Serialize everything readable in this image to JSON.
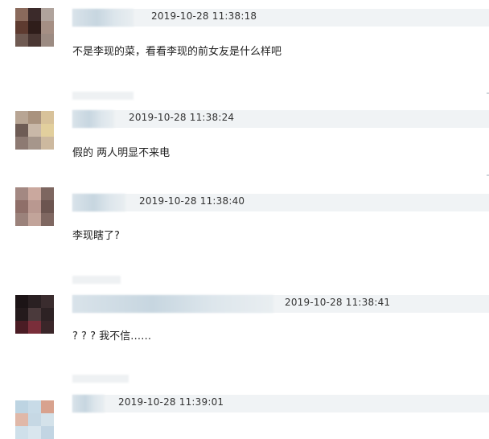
{
  "comments": [
    {
      "timestamp": "2019-10-28 11:38:18",
      "text": "不是李现的菜，看看李现的前女友是什么样吧",
      "avatar_colors": [
        "#8a6a5c",
        "#3b2a2a",
        "#b0a39c",
        "#5e3b30",
        "#2f1d1a",
        "#a58f84",
        "#6f5a52",
        "#4a3733",
        "#9c8b82"
      ]
    },
    {
      "timestamp": "2019-10-28 11:38:24",
      "text": "假的 两人明显不来电",
      "avatar_colors": [
        "#b8a594",
        "#a9927e",
        "#d8c29a",
        "#6e5c55",
        "#c9b8a8",
        "#e2cf9d",
        "#8d7a72",
        "#a6968b",
        "#cdb99f"
      ]
    },
    {
      "timestamp": "2019-10-28 11:38:40",
      "text": "李现瞎了?",
      "avatar_colors": [
        "#a38882",
        "#caa89e",
        "#7d6660",
        "#8f6f69",
        "#b99890",
        "#6c5550",
        "#9b827b",
        "#c2a49a",
        "#7f6761"
      ]
    },
    {
      "timestamp": "2019-10-28 11:38:41",
      "text": "? ? ? 我不信……",
      "avatar_colors": [
        "#1c1416",
        "#2a2022",
        "#3a2c2e",
        "#241a1c",
        "#4b3a3c",
        "#2d2224",
        "#4a1c24",
        "#7a2e3a",
        "#3a2629"
      ]
    },
    {
      "timestamp": "2019-10-28 11:39:01",
      "text": "",
      "avatar_colors": [
        "#bdd4e2",
        "#c8dbe7",
        "#d8a28e",
        "#e0b8a8",
        "#c6d8e4",
        "#d4e2ea",
        "#cfe0ea",
        "#d9e6ee",
        "#c2d5e3"
      ]
    }
  ]
}
